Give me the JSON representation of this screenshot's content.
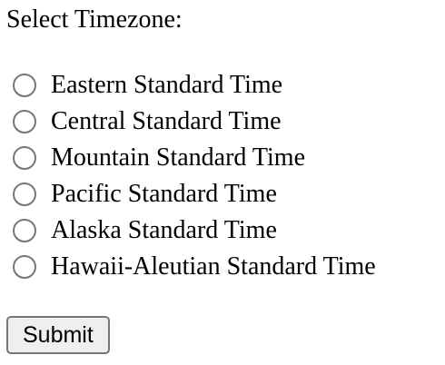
{
  "form": {
    "heading": "Select Timezone:",
    "options": [
      {
        "label": "Eastern Standard Time",
        "checked": false
      },
      {
        "label": "Central Standard Time",
        "checked": false
      },
      {
        "label": "Mountain Standard Time",
        "checked": false
      },
      {
        "label": "Pacific Standard Time",
        "checked": false
      },
      {
        "label": "Alaska Standard Time",
        "checked": false
      },
      {
        "label": "Hawaii-Aleutian Standard Time",
        "checked": false
      }
    ],
    "submit_label": "Submit"
  },
  "colors": {
    "text": "#000000",
    "background": "#ffffff",
    "radio_border": "#767676",
    "button_background": "#efefef",
    "button_border": "#767676"
  }
}
